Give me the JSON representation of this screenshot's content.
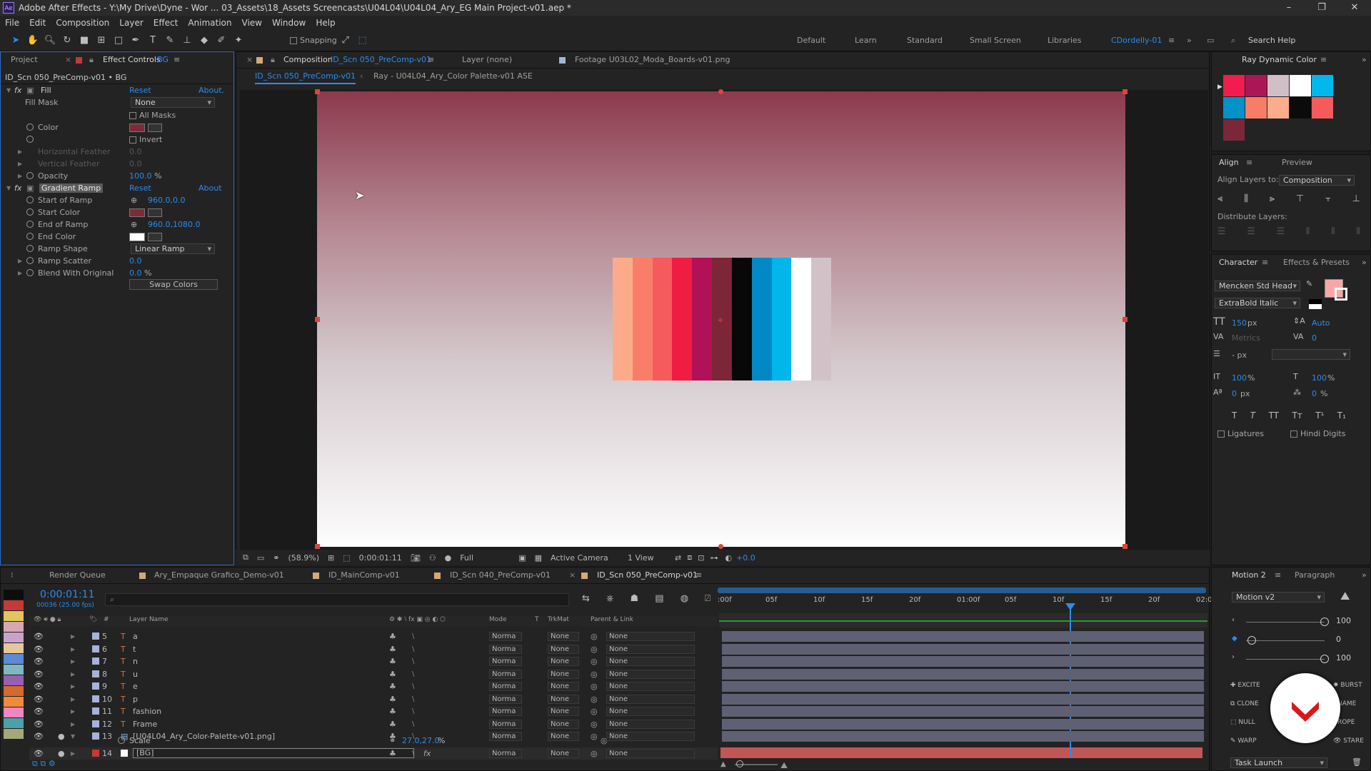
{
  "titlebar": {
    "title": "Adobe After Effects - Y:\\My Drive\\Dyne - Wor ... 03_Assets\\18_Assets Screencasts\\U04L04\\U04L04_Ary_EG Main Project-v01.aep *"
  },
  "menu": [
    "File",
    "Edit",
    "Composition",
    "Layer",
    "Effect",
    "Animation",
    "View",
    "Window",
    "Help"
  ],
  "toolbar": {
    "snapping": "Snapping",
    "workspaces": [
      "Default",
      "Learn",
      "Standard",
      "Small Screen",
      "Libraries",
      "CDordelly-01"
    ],
    "search_placeholder": "Search Help"
  },
  "effect_controls": {
    "tab_project": "Project",
    "tab_effect": "Effect Controls",
    "tab_effect_layer": "BG",
    "header": "ID_Scn 050_PreComp-v01 • BG",
    "fill": {
      "name": "Fill",
      "reset": "Reset",
      "about": "About.",
      "fill_mask_label": "Fill Mask",
      "fill_mask_value": "None",
      "all_masks": "All Masks",
      "color_label": "Color",
      "color": "#7d2b39",
      "invert": "Invert",
      "hfeather": "Horizontal Feather",
      "hfeather_val": "0.0",
      "vfeather": "Vertical Feather",
      "vfeather_val": "0.0",
      "opacity_label": "Opacity",
      "opacity": "100.0",
      "opacity_unit": "%"
    },
    "gradient": {
      "name": "Gradient Ramp",
      "reset": "Reset",
      "about": "About",
      "start_label": "Start of Ramp",
      "start": "960.0,0.0",
      "start_color_label": "Start Color",
      "start_color": "#7d2b39",
      "end_label": "End of Ramp",
      "end": "960.0,1080.0",
      "end_color_label": "End Color",
      "end_color": "#ffffff",
      "shape_label": "Ramp Shape",
      "shape": "Linear Ramp",
      "scatter_label": "Ramp Scatter",
      "scatter": "0.0",
      "blend_label": "Blend With Original",
      "blend": "0.0",
      "blend_unit": "%",
      "swap": "Swap Colors"
    }
  },
  "viewer": {
    "tab_comp_prefix": "Composition",
    "tab_comp": "ID_Scn 050_PreComp-v01",
    "tab_layer": "Layer (none)",
    "tab_footage": "Footage U03L02_Moda_Boards-v01.png",
    "crumb1": "ID_Scn 050_PreComp-v01",
    "crumb2": "Ray - U04L04_Ary_Color Palette-v01 ASE",
    "palette": [
      "#fcab8a",
      "#f97e6a",
      "#f55a5c",
      "#ef1c44",
      "#b01157",
      "#7c2637",
      "#080808",
      "#0089c5",
      "#00b6ea",
      "#ffffff",
      "#d2c2c8"
    ],
    "footer": {
      "zoom": "(58.9%)",
      "time": "0:00:01:11",
      "resolution": "Full",
      "camera": "Active Camera",
      "view": "1 View",
      "exposure": "+0.0"
    }
  },
  "ray_dynamic": {
    "title": "Ray Dynamic Color",
    "swatches": [
      "#f21c4f",
      "#ab1656",
      "#d0bfc6",
      "#ffffff",
      "#00b8ec",
      "#0092c9",
      "#f97d66",
      "#fcac8c",
      "#0b0b0b",
      "#f55a5d",
      "#7c2739"
    ]
  },
  "align": {
    "tab_align": "Align",
    "tab_preview": "Preview",
    "layers_to_label": "Align Layers to:",
    "layers_to": "Composition",
    "distribute": "Distribute Layers:"
  },
  "character": {
    "tab_char": "Character",
    "tab_effects": "Effects & Presets",
    "font": "Mencken Std Head",
    "style": "ExtraBold Italic",
    "size": "150",
    "size_unit": "px",
    "leading": "Auto",
    "tracking_metrics": "Metrics",
    "tracking": "0",
    "stroke": "- px",
    "vscale": "100",
    "vscale_unit": "%",
    "hscale": "100",
    "hscale_unit": "%",
    "baseline": "0",
    "baseline_unit": "px",
    "tsume": "0",
    "tsume_unit": "%",
    "ligatures": "Ligatures",
    "hindi": "Hindi Digits",
    "fill_color": "#f7a7a7"
  },
  "timeline": {
    "tabs": [
      "Render Queue",
      "Ary_Empaque Grafico_Demo-v01",
      "ID_MainComp-v01",
      "ID_Scn 040_PreComp-v01",
      "ID_Scn 050_PreComp-v01"
    ],
    "timecode": "0:00:01:11",
    "frames": "00036 (25.00 fps)",
    "headers": {
      "num": "#",
      "name": "Layer Name",
      "mode": "Mode",
      "t": "T",
      "trkmat": "TrkMat",
      "parent": "Parent & Link"
    },
    "ruler": [
      ":00f",
      "05f",
      "10f",
      "15f",
      "20f",
      "01:00f",
      "05f",
      "10f",
      "15f",
      "20f",
      "02:0"
    ],
    "layers": [
      {
        "num": "5",
        "name": "a",
        "mode": "Norma",
        "trk": "None",
        "parent": "None"
      },
      {
        "num": "6",
        "name": "t",
        "mode": "Norma",
        "trk": "None",
        "parent": "None"
      },
      {
        "num": "7",
        "name": "n",
        "mode": "Norma",
        "trk": "None",
        "parent": "None"
      },
      {
        "num": "8",
        "name": "u",
        "mode": "Norma",
        "trk": "None",
        "parent": "None"
      },
      {
        "num": "9",
        "name": "e",
        "mode": "Norma",
        "trk": "None",
        "parent": "None"
      },
      {
        "num": "10",
        "name": "p",
        "mode": "Norma",
        "trk": "None",
        "parent": "None"
      },
      {
        "num": "11",
        "name": "fashion",
        "mode": "Norma",
        "trk": "None",
        "parent": "None"
      },
      {
        "num": "12",
        "name": "Frame",
        "mode": "Norma",
        "trk": "None",
        "parent": "None"
      },
      {
        "num": "13",
        "name": "[U04L04_Ary_Color-Palette-v01.png]",
        "mode": "Norma",
        "trk": "None",
        "parent": "None"
      }
    ],
    "scale_label": "Scale",
    "scale_value": "27.0,27.0",
    "scale_unit": "%",
    "bg_layer": {
      "num": "14",
      "name": "[BG]",
      "mode": "Norma",
      "trk": "None",
      "parent": "None"
    }
  },
  "label_colors": [
    "#0d0d0d",
    "#c33a36",
    "#e1c65d",
    "#d7a7b3",
    "#c9a2c9",
    "#e6c69a",
    "#5d8bd1",
    "#7fb6c1",
    "#9a5fb0",
    "#d46a2f",
    "#f18a3c",
    "#f286c2",
    "#4da0a6",
    "#a5a879"
  ],
  "motion": {
    "tab": "Motion 2",
    "tab2": "Paragraph",
    "version": "Motion v2",
    "v1": "100",
    "v2": "0",
    "v3": "100",
    "excite": "EXCITE",
    "burst": "BURST",
    "clone": "CLONE",
    "name": "NAME",
    "null": "NULL",
    "rope": "ROPE",
    "warp": "WARP",
    "stare": "STARE",
    "task": "Task Launch"
  }
}
